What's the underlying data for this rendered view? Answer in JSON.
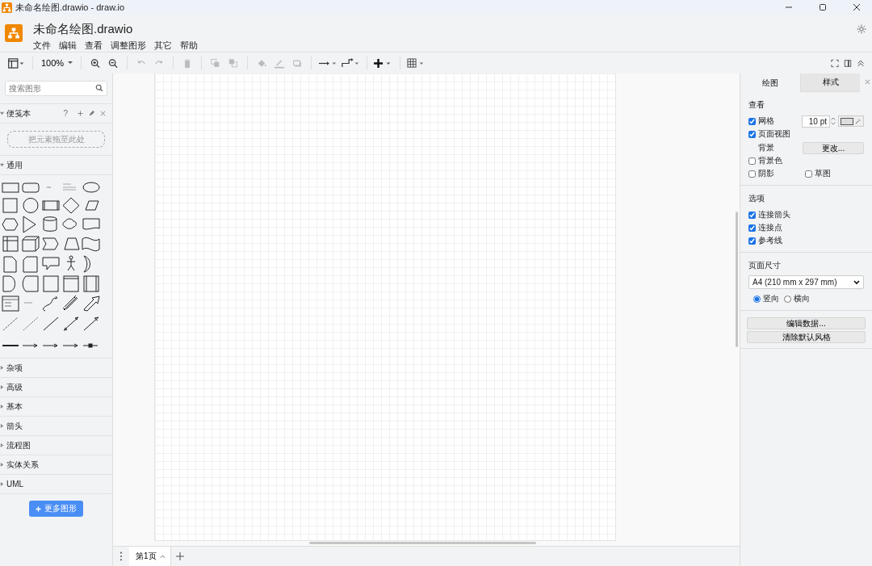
{
  "window": {
    "title": "未命名绘图.drawio - draw.io"
  },
  "header": {
    "file_title": "未命名绘图.drawio",
    "menu": [
      "文件",
      "编辑",
      "查看",
      "调整图形",
      "其它",
      "帮助"
    ]
  },
  "toolbar": {
    "zoom": "100%"
  },
  "sidebar": {
    "search": {
      "placeholder": "搜索图形"
    },
    "scratchpad": {
      "title": "便笺本",
      "expanded": true,
      "help": "?",
      "drop_hint": "把元素拖至此处"
    },
    "sections": [
      {
        "label": "通用",
        "expanded": true
      },
      {
        "label": "杂项",
        "expanded": false
      },
      {
        "label": "高级",
        "expanded": false
      },
      {
        "label": "基本",
        "expanded": false
      },
      {
        "label": "箭头",
        "expanded": false
      },
      {
        "label": "流程图",
        "expanded": false
      },
      {
        "label": "实体关系",
        "expanded": false
      },
      {
        "label": "UML",
        "expanded": false
      }
    ],
    "more_button": "更多图形"
  },
  "format_panel": {
    "tabs": [
      {
        "label": "绘图",
        "selected": true
      },
      {
        "label": "样式",
        "selected": false
      }
    ],
    "view": {
      "heading": "查看",
      "grid": {
        "label": "网格",
        "checked": true,
        "size": "10 pt"
      },
      "page_view": {
        "label": "页面视图",
        "checked": true
      },
      "background": {
        "label": "背景",
        "button": "更改..."
      },
      "background_color": {
        "label": "背景色",
        "checked": false
      },
      "shadow": {
        "label": "阴影",
        "checked": false
      },
      "sketch": {
        "label": "草图",
        "checked": false
      }
    },
    "options": {
      "heading": "选项",
      "items": [
        {
          "label": "连接箭头",
          "checked": true
        },
        {
          "label": "连接点",
          "checked": true
        },
        {
          "label": "参考线",
          "checked": true
        }
      ]
    },
    "page_size": {
      "heading": "页面尺寸",
      "paper": "A4 (210 mm x 297 mm)",
      "orientation": [
        {
          "label": "竖向",
          "selected": true
        },
        {
          "label": "横向",
          "selected": false
        }
      ]
    },
    "buttons": [
      "编辑数据...",
      "清除默认风格"
    ]
  },
  "pages": [
    {
      "label": "第1页",
      "selected": true
    }
  ]
}
